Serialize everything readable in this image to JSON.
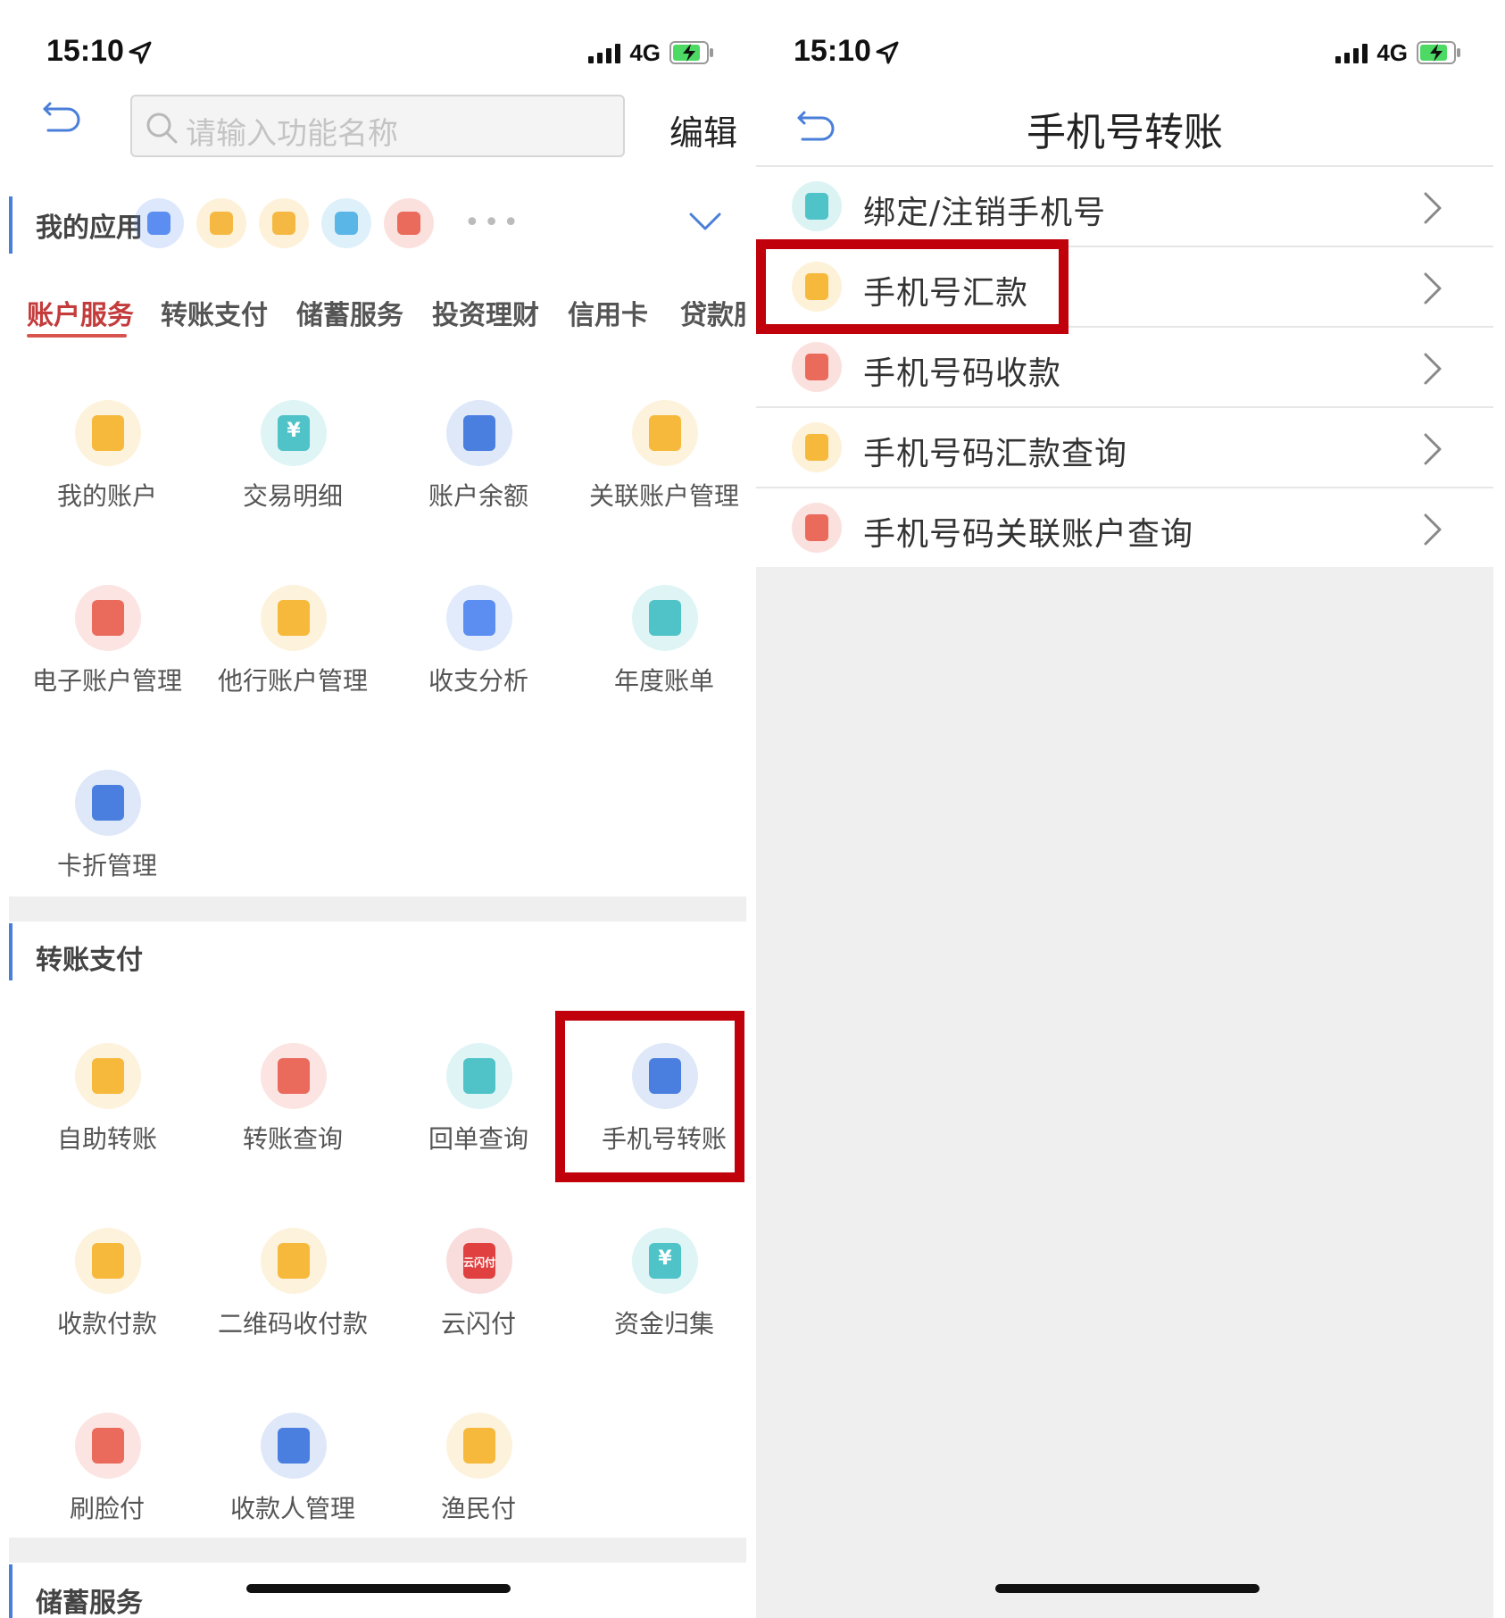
{
  "left": {
    "status": {
      "time": "15:10",
      "network": "4G"
    },
    "search": {
      "placeholder": "请输入功能名称"
    },
    "edit_label": "编辑",
    "my_apps": {
      "title": "我的应用",
      "items": [
        {
          "icon": "card-icon",
          "color": "#5b8ef0"
        },
        {
          "icon": "medical-kit-icon",
          "color": "#f5b943"
        },
        {
          "icon": "loan-icon",
          "color": "#f5b943"
        },
        {
          "icon": "finance-icon",
          "color": "#5bb6e8"
        },
        {
          "icon": "exchange-icon",
          "color": "#ea6a5c"
        }
      ]
    },
    "tabs": [
      "账户服务",
      "转账支付",
      "储蓄服务",
      "投资理财",
      "信用卡",
      "贷款服"
    ],
    "account_services": [
      {
        "label": "我的账户",
        "icon": "wallet-icon",
        "color": "#f6b93b"
      },
      {
        "label": "交易明细",
        "icon": "receipt-icon",
        "color": "#4fc3c7",
        "mark": "¥"
      },
      {
        "label": "账户余额",
        "icon": "balance-icon",
        "color": "#4a7fe0"
      },
      {
        "label": "关联账户管理",
        "icon": "link-account-icon",
        "color": "#f6b93b"
      },
      {
        "label": "电子账户管理",
        "icon": "e-card-icon",
        "color": "#ea6a5c"
      },
      {
        "label": "他行账户管理",
        "icon": "other-bank-card-icon",
        "color": "#f6b93b"
      },
      {
        "label": "收支分析",
        "icon": "chart-icon",
        "color": "#5b8ef0"
      },
      {
        "label": "年度账单",
        "icon": "pie-chart-icon",
        "color": "#4fc3c7"
      },
      {
        "label": "卡折管理",
        "icon": "passbook-icon",
        "color": "#4a7fe0"
      }
    ],
    "transfer_section_title": "转账支付",
    "transfer_items": [
      {
        "label": "自助转账",
        "icon": "self-transfer-icon",
        "color": "#f6b93b"
      },
      {
        "label": "转账查询",
        "icon": "transfer-query-icon",
        "color": "#ea6a5c"
      },
      {
        "label": "回单查询",
        "icon": "receipt-query-icon",
        "color": "#4fc3c7"
      },
      {
        "label": "手机号转账",
        "icon": "phone-transfer-icon",
        "color": "#4a7fe0"
      },
      {
        "label": "收款付款",
        "icon": "pay-collect-icon",
        "color": "#f6b93b"
      },
      {
        "label": "二维码收付款",
        "icon": "qr-code-icon",
        "color": "#f6b93b"
      },
      {
        "label": "云闪付",
        "icon": "unionpay-icon",
        "color": "#e04040",
        "mark": "云闪付"
      },
      {
        "label": "资金归集",
        "icon": "fund-collect-icon",
        "color": "#4fc3c7",
        "mark": "¥"
      },
      {
        "label": "刷脸付",
        "icon": "face-pay-icon",
        "color": "#ea6a5c"
      },
      {
        "label": "收款人管理",
        "icon": "payee-icon",
        "color": "#4a7fe0"
      },
      {
        "label": "渔民付",
        "icon": "fisherman-pay-icon",
        "color": "#f6b93b"
      }
    ],
    "savings_section_title": "储蓄服务"
  },
  "right": {
    "status": {
      "time": "15:10",
      "network": "4G"
    },
    "title": "手机号转账",
    "items": [
      {
        "label": "绑定/注销手机号",
        "icon": "phone-bind-icon",
        "color": "#4fc3c7"
      },
      {
        "label": "手机号汇款",
        "icon": "phone-remit-icon",
        "color": "#f6b93b"
      },
      {
        "label": "手机号码收款",
        "icon": "phone-receive-icon",
        "color": "#ea6a5c"
      },
      {
        "label": "手机号码汇款查询",
        "icon": "remit-query-icon",
        "color": "#f6b93b"
      },
      {
        "label": "手机号码关联账户查询",
        "icon": "linked-account-query-icon",
        "color": "#ea6a5c"
      }
    ]
  },
  "colors": {
    "highlight": "#c0000a",
    "accent_blue": "#4a7fd9",
    "tab_active": "#c43b3b"
  }
}
